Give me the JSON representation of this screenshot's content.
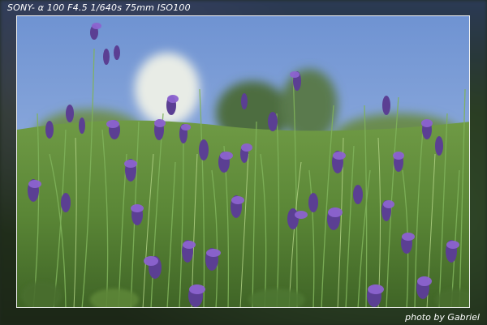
{
  "image": {
    "exif_text": "SONY- α 100 F4.5 1/640s 75mm ISO100",
    "credit_text": "photo by Gabriel",
    "subject": "lavender-field",
    "colors": {
      "sky": "#7ea0d8",
      "foliage": "#5f8f3c",
      "lavender": "#6a4aa8",
      "frame_border": "#f2f2f2",
      "caption_text": "#ffffff"
    }
  }
}
